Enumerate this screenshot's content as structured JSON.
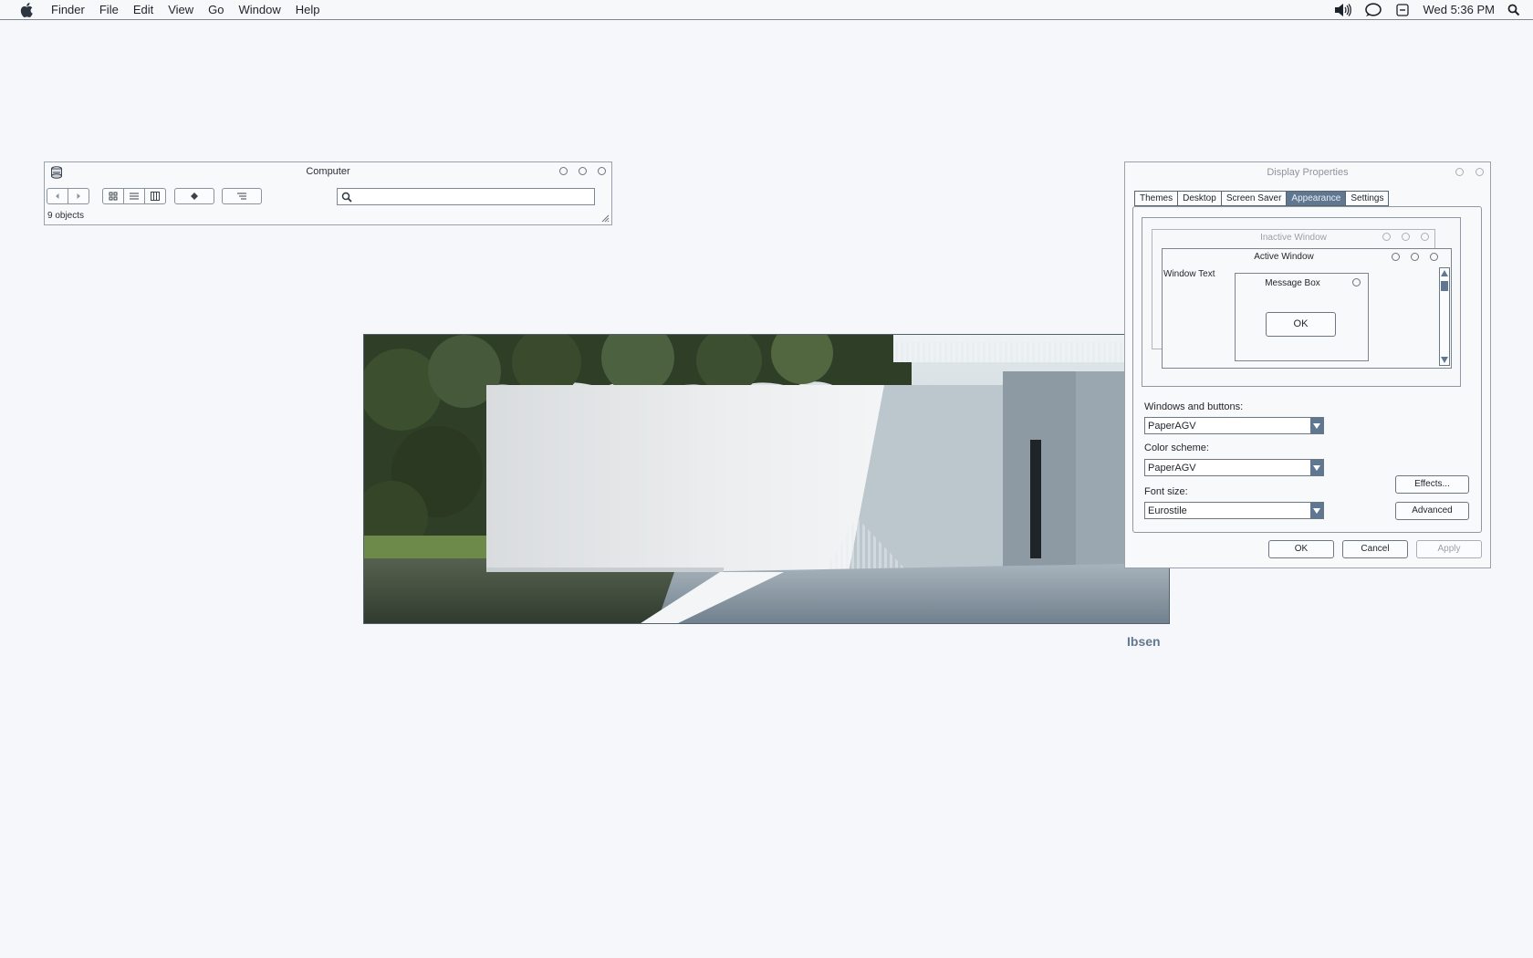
{
  "menubar": {
    "items": [
      "Finder",
      "File",
      "Edit",
      "View",
      "Go",
      "Window",
      "Help"
    ],
    "clock": "Wed 5:36 PM"
  },
  "finder": {
    "title": "Computer",
    "status": "9 objects",
    "search_placeholder": ""
  },
  "photo": {
    "caption": "Ibsen"
  },
  "display_properties": {
    "title": "Display Properties",
    "tabs": [
      "Themes",
      "Desktop",
      "Screen Saver",
      "Appearance",
      "Settings"
    ],
    "active_tab": "Appearance",
    "preview": {
      "inactive_title": "Inactive Window",
      "active_title": "Active Window",
      "window_text": "Window Text",
      "message_title": "Message Box",
      "message_ok": "OK"
    },
    "windows_buttons_label": "Windows and buttons:",
    "windows_buttons_value": "PaperAGV",
    "color_scheme_label": "Color scheme:",
    "color_scheme_value": "PaperAGV",
    "font_size_label": "Font size:",
    "font_size_value": "Eurostile",
    "effects_button": "Effects...",
    "advanced_button": "Advanced",
    "ok_button": "OK",
    "cancel_button": "Cancel",
    "apply_button": "Apply"
  },
  "colors": {
    "accent": "#5f7791",
    "background": "#f5f7fa",
    "caption": "#62788f"
  }
}
